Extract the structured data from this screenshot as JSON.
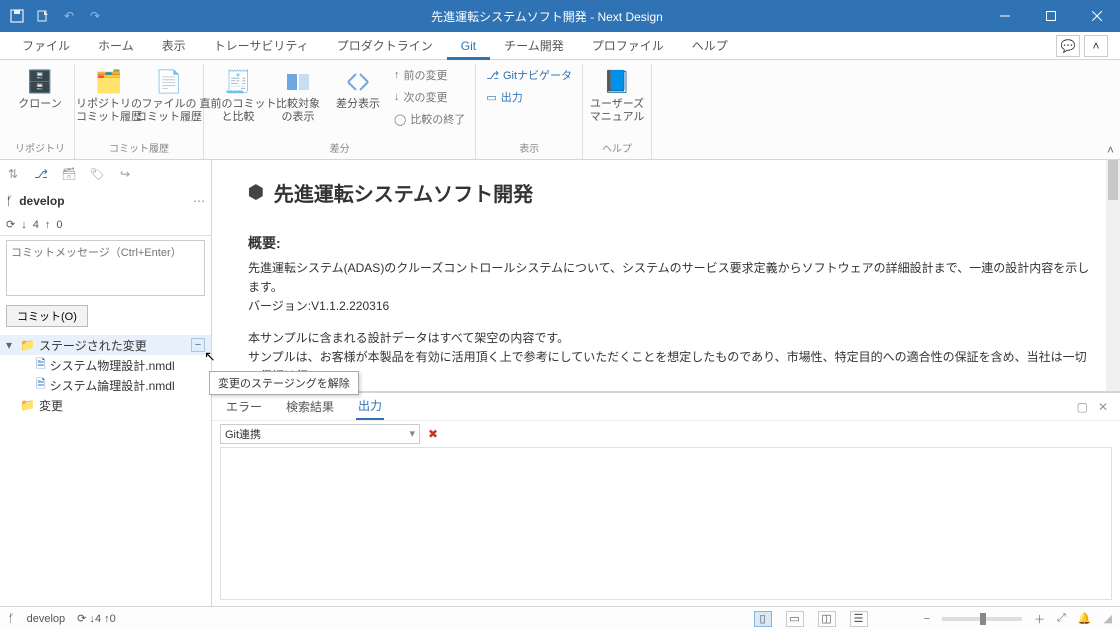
{
  "title": "先進運転システムソフト開発 - Next Design",
  "tabs": {
    "file": "ファイル",
    "home": "ホーム",
    "view": "表示",
    "trace": "トレーサビリティ",
    "product": "プロダクトライン",
    "git": "Git",
    "team": "チーム開発",
    "profile": "プロファイル",
    "help": "ヘルプ"
  },
  "ribbon": {
    "repo": {
      "clone": "クローン",
      "repoHist": "リポジトリの\nコミット履歴",
      "fileHist": "ファイルの\nコミット履歴",
      "label": "リポジトリ",
      "histLabel": "コミット履歴"
    },
    "diff": {
      "comparePrev": "直前のコミット\nと比較",
      "compareTarget": "比較対象\nの表示",
      "diffView": "差分表示",
      "prevChange": "前の変更",
      "nextChange": "次の変更",
      "endCompare": "比較の終了",
      "label": "差分"
    },
    "disp": {
      "gitNav": "Gitナビゲータ",
      "output": "出力",
      "label": "表示"
    },
    "helpG": {
      "manual": "ユーザーズ\nマニュアル",
      "label": "ヘルプ"
    }
  },
  "side": {
    "branch": "develop",
    "down": "4",
    "up": "0",
    "commitPlaceholder": "コミットメッセージ（Ctrl+Enter）",
    "commitBtn": "コミット(O)",
    "staged": "ステージされた変更",
    "file1": "システム物理設計.nmdl",
    "file2": "システム論理設計.nmdl",
    "changes": "変更"
  },
  "tooltip": "変更のステージングを解除",
  "doc": {
    "title": "先進運転システムソフト開発",
    "h2": "概要:",
    "p1": "先進運転システム(ADAS)のクルーズコントロールシステムについて、システムのサービス要求定義からソフトウェアの詳細設計まで、一連の設計内容を示します。",
    "p2": "バージョン:V1.1.2.220316",
    "p3": "本サンプルに含まれる設計データはすべて架空の内容です。",
    "p4": "サンプルは、お客様が本製品を有効に活用頂く上で参考にしていただくことを想定したものであり、市場性、特定目的への適合性の保証を含め、当社は一切の保証は行"
  },
  "out": {
    "err": "エラー",
    "search": "検索結果",
    "output": "出力",
    "combo": "Git連携"
  },
  "status": {
    "branch": "develop",
    "down": "4",
    "up": "0"
  }
}
